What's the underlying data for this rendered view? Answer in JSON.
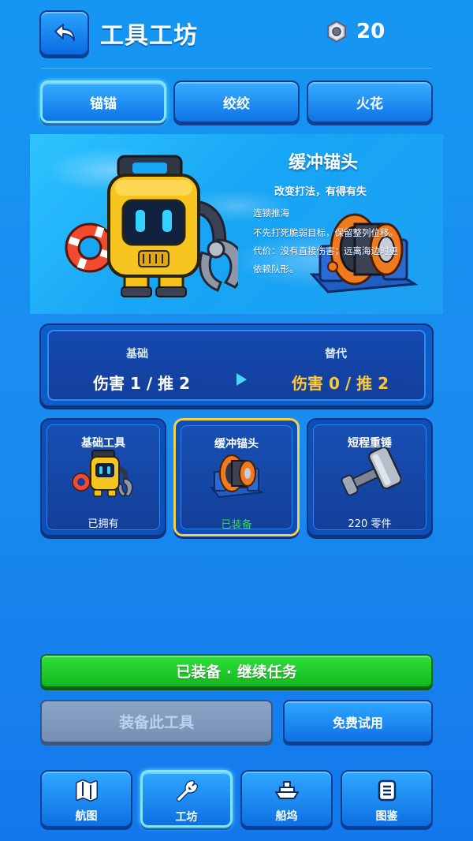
{
  "header": {
    "title": "工具工坊",
    "currency_icon": "hex-nut-icon",
    "currency_value": "20"
  },
  "tabs": [
    {
      "label": "锚锚",
      "active": true
    },
    {
      "label": "绞绞",
      "active": false
    },
    {
      "label": "火花",
      "active": false
    }
  ],
  "hero": {
    "name": "缓冲锚头",
    "tagline": "改变打法，有得有失",
    "lines": [
      "连锁推海",
      "不先打死脆弱目标，保留整列位移。",
      "代价：没有直接伤害；远离海边时更",
      "依赖队形。"
    ]
  },
  "comparison": {
    "base_label": "基础",
    "base_value": "伤害 1 / 推 2",
    "alt_label": "替代",
    "alt_value": "伤害 0 / 推 2",
    "alt_color": "#ffc93a"
  },
  "tools": [
    {
      "name": "基础工具",
      "status": "已拥有",
      "icon": "robot-crab-icon"
    },
    {
      "name": "缓冲锚头",
      "status": "已装备",
      "icon": "buffer-reel-icon",
      "selected": true
    },
    {
      "name": "短程重锤",
      "status": "220 零件",
      "icon": "hammer-icon"
    }
  ],
  "actions": {
    "primary": "已装备 · 继续任务",
    "equip": "装备此工具",
    "trial": "免费试用"
  },
  "nav": [
    {
      "label": "航图",
      "icon": "map-icon"
    },
    {
      "label": "工坊",
      "icon": "wrench-icon",
      "active": true
    },
    {
      "label": "船坞",
      "icon": "ship-icon"
    },
    {
      "label": "图鉴",
      "icon": "codex-icon"
    }
  ]
}
